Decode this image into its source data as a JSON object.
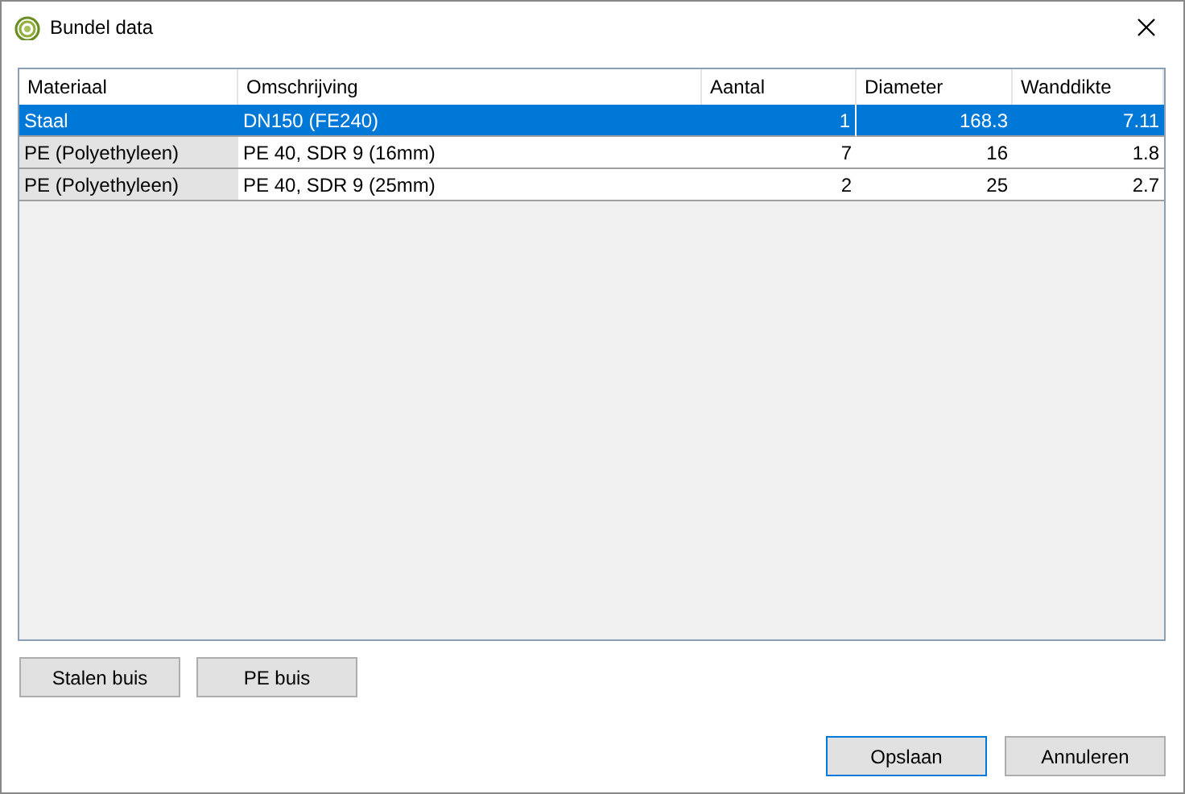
{
  "window": {
    "title": "Bundel data"
  },
  "table": {
    "columns": [
      {
        "label": "Materiaal",
        "kind": "text"
      },
      {
        "label": "Omschrijving",
        "kind": "text"
      },
      {
        "label": "Aantal",
        "kind": "number"
      },
      {
        "label": "Diameter",
        "kind": "number"
      },
      {
        "label": "Wanddikte",
        "kind": "number"
      }
    ],
    "rows": [
      {
        "selected": true,
        "cells": [
          "Staal",
          "DN150 (FE240)",
          "1",
          "168.3",
          "7.11"
        ]
      },
      {
        "selected": false,
        "cells": [
          "PE (Polyethyleen)",
          "PE 40, SDR 9 (16mm)",
          "7",
          "16",
          "1.8"
        ]
      },
      {
        "selected": false,
        "cells": [
          "PE (Polyethyleen)",
          "PE 40, SDR 9 (25mm)",
          "2",
          "25",
          "2.7"
        ]
      }
    ]
  },
  "add_buttons": [
    {
      "label": "Stalen buis"
    },
    {
      "label": "PE buis"
    }
  ],
  "dialog_buttons": [
    {
      "label": "Opslaan",
      "default": true
    },
    {
      "label": "Annuleren",
      "default": false
    }
  ]
}
